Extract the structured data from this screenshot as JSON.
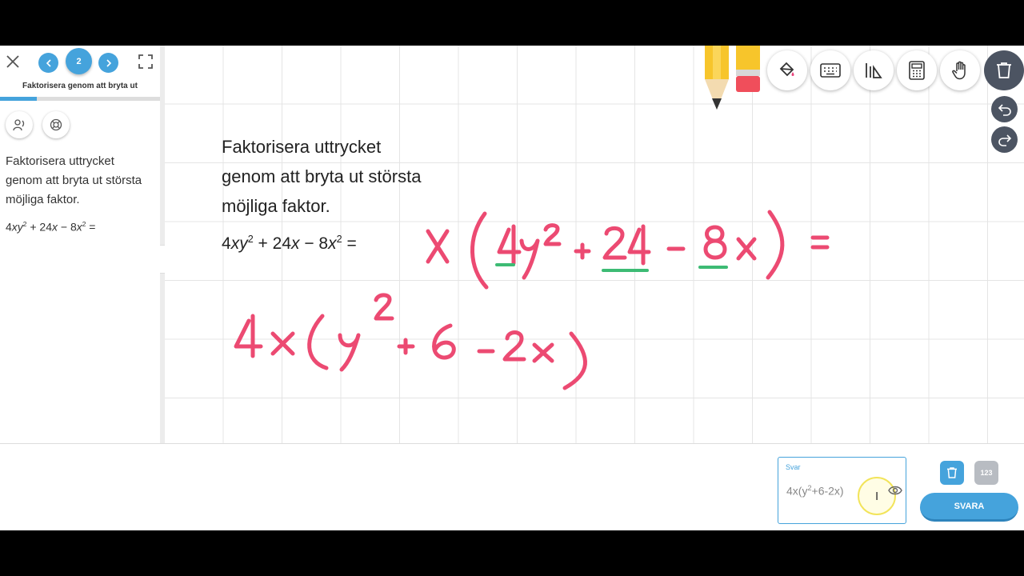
{
  "sidebar": {
    "current_page": "2",
    "title": "Faktorisera genom att bryta ut",
    "progress": 0.23,
    "task_text": "Faktorisera uttrycket genom att bryta ut största möjliga faktor.",
    "expression": {
      "a": "4",
      "b": "xy",
      "c": "2",
      "d": " + 24",
      "e": "x",
      "f": " − 8",
      "g": "x",
      "h": "2",
      "i": " ="
    }
  },
  "workspace": {
    "task_text": "Faktorisera uttrycket genom att bryta ut största möjliga faktor.",
    "expression": {
      "a": "4",
      "b": "xy",
      "c": "2",
      "d": " + 24",
      "e": "x",
      "f": " − 8",
      "g": "x",
      "h": "2",
      "i": " ="
    },
    "ink_color": "#ec4a72",
    "underline_color": "#3dbb74"
  },
  "toolbar": {
    "pencil_color": "#f7c52b",
    "eraser_color": "#f04e5b",
    "buttons": [
      "paint-bucket-icon",
      "keyboard-icon",
      "ruler-icon",
      "calculator-icon",
      "hand-icon"
    ],
    "trash_bg": "#4c5462"
  },
  "answer": {
    "label": "Svar",
    "value_prefix": "4x(y",
    "value_sup": "2",
    "value_suffix": "+6-2x)",
    "keypad_label": "123",
    "submit_label": "SVARA",
    "accent": "#45a3dc"
  }
}
